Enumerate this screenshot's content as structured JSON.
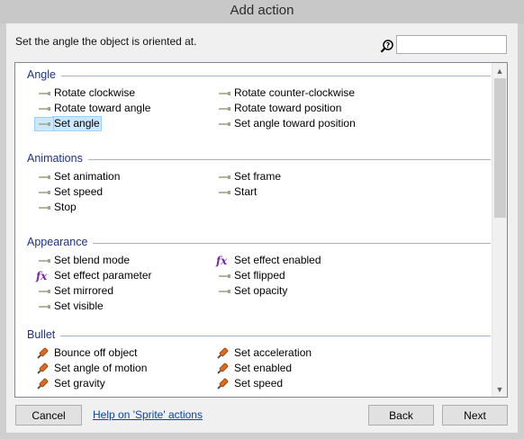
{
  "window": {
    "title": "Add action"
  },
  "description": "Set the angle the object is oriented at.",
  "search": {
    "value": "",
    "placeholder": ""
  },
  "categories": [
    {
      "title": "Angle",
      "items": [
        {
          "label": "Rotate clockwise",
          "icon": "action-icon"
        },
        {
          "label": "Rotate counter-clockwise",
          "icon": "action-icon"
        },
        {
          "label": "Rotate toward angle",
          "icon": "action-icon"
        },
        {
          "label": "Rotate toward position",
          "icon": "action-icon"
        },
        {
          "label": "Set angle",
          "icon": "action-icon",
          "selected": true
        },
        {
          "label": "Set angle toward position",
          "icon": "action-icon"
        }
      ]
    },
    {
      "title": "Animations",
      "items": [
        {
          "label": "Set animation",
          "icon": "action-icon"
        },
        {
          "label": "Set frame",
          "icon": "action-icon"
        },
        {
          "label": "Set speed",
          "icon": "action-icon"
        },
        {
          "label": "Start",
          "icon": "action-icon"
        },
        {
          "label": "Stop",
          "icon": "action-icon"
        }
      ]
    },
    {
      "title": "Appearance",
      "items": [
        {
          "label": "Set blend mode",
          "icon": "action-icon"
        },
        {
          "label": "Set effect enabled",
          "icon": "fx-icon"
        },
        {
          "label": "Set effect parameter",
          "icon": "fx-icon"
        },
        {
          "label": "Set flipped",
          "icon": "action-icon"
        },
        {
          "label": "Set mirrored",
          "icon": "action-icon"
        },
        {
          "label": "Set opacity",
          "icon": "action-icon"
        },
        {
          "label": "Set visible",
          "icon": "action-icon"
        }
      ]
    },
    {
      "title": "Bullet",
      "items": [
        {
          "label": "Bounce off object",
          "icon": "bullet-icon"
        },
        {
          "label": "Set acceleration",
          "icon": "bullet-icon"
        },
        {
          "label": "Set angle of motion",
          "icon": "bullet-icon"
        },
        {
          "label": "Set enabled",
          "icon": "bullet-icon"
        },
        {
          "label": "Set gravity",
          "icon": "bullet-icon"
        },
        {
          "label": "Set speed",
          "icon": "bullet-icon"
        }
      ]
    }
  ],
  "buttons": {
    "cancel": "Cancel",
    "back": "Back",
    "next": "Next"
  },
  "help_link": "Help on 'Sprite' actions",
  "colors": {
    "category_title": "#1e3287",
    "link": "#0645ad",
    "selection": "#cce8ff",
    "fx": "#7a2aa6",
    "bullet": "#e06a1c"
  }
}
